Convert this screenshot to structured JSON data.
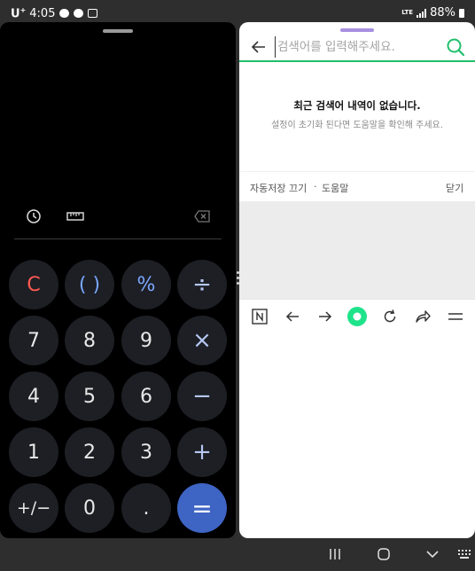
{
  "status_bar": {
    "carrier": "U",
    "carrier_sup": "+",
    "time": "4:05",
    "network": "LTE",
    "battery": "88%"
  },
  "calculator": {
    "keys": [
      {
        "label": "C",
        "style": "red",
        "name": "clear-button"
      },
      {
        "label": "( )",
        "style": "blue",
        "name": "parentheses-button"
      },
      {
        "label": "%",
        "style": "blue",
        "name": "percent-button"
      },
      {
        "label": "÷",
        "style": "op",
        "name": "divide-button"
      },
      {
        "label": "7",
        "style": "num",
        "name": "digit-7-button"
      },
      {
        "label": "8",
        "style": "num",
        "name": "digit-8-button"
      },
      {
        "label": "9",
        "style": "num",
        "name": "digit-9-button"
      },
      {
        "label": "×",
        "style": "op",
        "name": "multiply-button"
      },
      {
        "label": "4",
        "style": "num",
        "name": "digit-4-button"
      },
      {
        "label": "5",
        "style": "num",
        "name": "digit-5-button"
      },
      {
        "label": "6",
        "style": "num",
        "name": "digit-6-button"
      },
      {
        "label": "−",
        "style": "op",
        "name": "minus-button"
      },
      {
        "label": "1",
        "style": "num",
        "name": "digit-1-button"
      },
      {
        "label": "2",
        "style": "num",
        "name": "digit-2-button"
      },
      {
        "label": "3",
        "style": "num",
        "name": "digit-3-button"
      },
      {
        "label": "+",
        "style": "op",
        "name": "plus-button"
      },
      {
        "label": "+/−",
        "style": "small",
        "name": "sign-toggle-button"
      },
      {
        "label": "0",
        "style": "num",
        "name": "digit-0-button"
      },
      {
        "label": ".",
        "style": "num",
        "name": "decimal-button"
      },
      {
        "label": "=",
        "style": "eq",
        "name": "equals-button"
      }
    ],
    "colors": {
      "background": "#000000",
      "key": "#1d1f24",
      "equals": "#3e64c4",
      "clear": "#ff5a52",
      "accent": "#7aa7ff"
    }
  },
  "browser": {
    "search": {
      "placeholder": "검색어를 입력해주세요."
    },
    "empty_state": {
      "title": "최근 검색어 내역이 없습니다.",
      "subtitle": "설정이 초기화 된다면 도움말을 확인해 주세요."
    },
    "options": {
      "autosave": "자동저장 끄기",
      "separator": "·",
      "help": "도움말",
      "close": "닫기"
    },
    "colors": {
      "accent": "#1fbf6b",
      "handle": "#a88fe0"
    }
  }
}
